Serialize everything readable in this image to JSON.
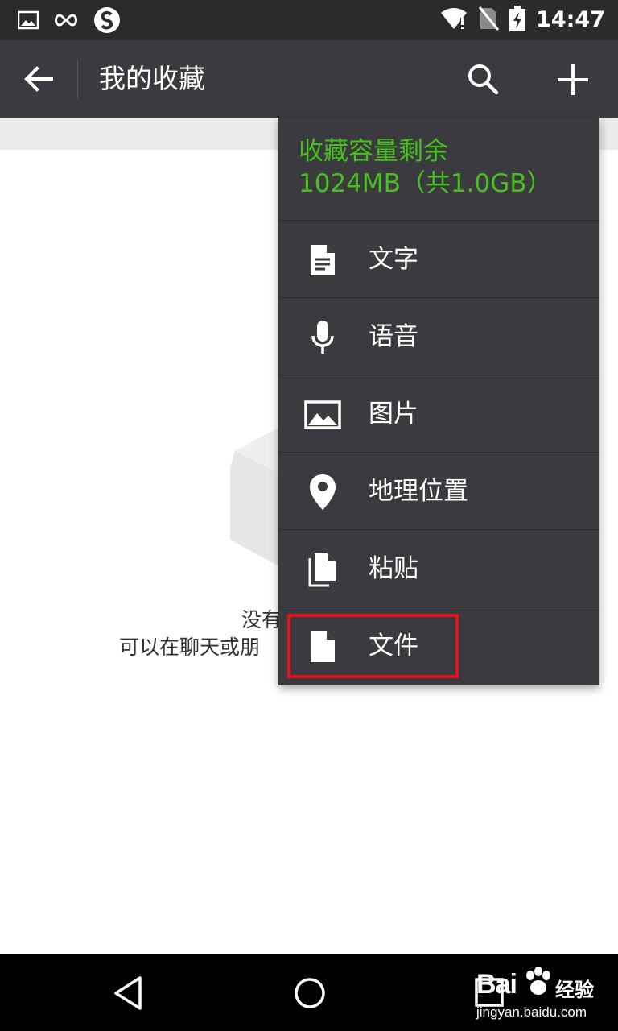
{
  "status_bar": {
    "time": "14:47",
    "icons": [
      "gallery-icon",
      "infinity-icon",
      "s-app-icon",
      "wifi-icon",
      "no-sim-icon",
      "battery-icon"
    ]
  },
  "toolbar": {
    "title": "我的收藏",
    "back_icon": "arrow-left-icon",
    "search_icon": "search-icon",
    "add_icon": "plus-icon"
  },
  "empty_state": {
    "line1_visible": "没有",
    "line2_visible": "可以在聊天或朋"
  },
  "menu": {
    "storage_line1": "收藏容量剩余",
    "storage_line2": "1024MB（共1.0GB）",
    "items": [
      {
        "label": "文字",
        "icon": "text-document-icon"
      },
      {
        "label": "语音",
        "icon": "microphone-icon"
      },
      {
        "label": "图片",
        "icon": "image-icon"
      },
      {
        "label": "地理位置",
        "icon": "location-pin-icon"
      },
      {
        "label": "粘贴",
        "icon": "paste-icon"
      },
      {
        "label": "文件",
        "icon": "file-icon"
      }
    ]
  },
  "colors": {
    "toolbar_bg": "#3a3a3f",
    "status_bg": "#2b2b2e",
    "accent_green": "#46c01c",
    "highlight_red": "#e0141e"
  },
  "watermark": {
    "brand": "Bai",
    "brand_suffix": "经验",
    "url": "jingyan.baidu.com"
  }
}
